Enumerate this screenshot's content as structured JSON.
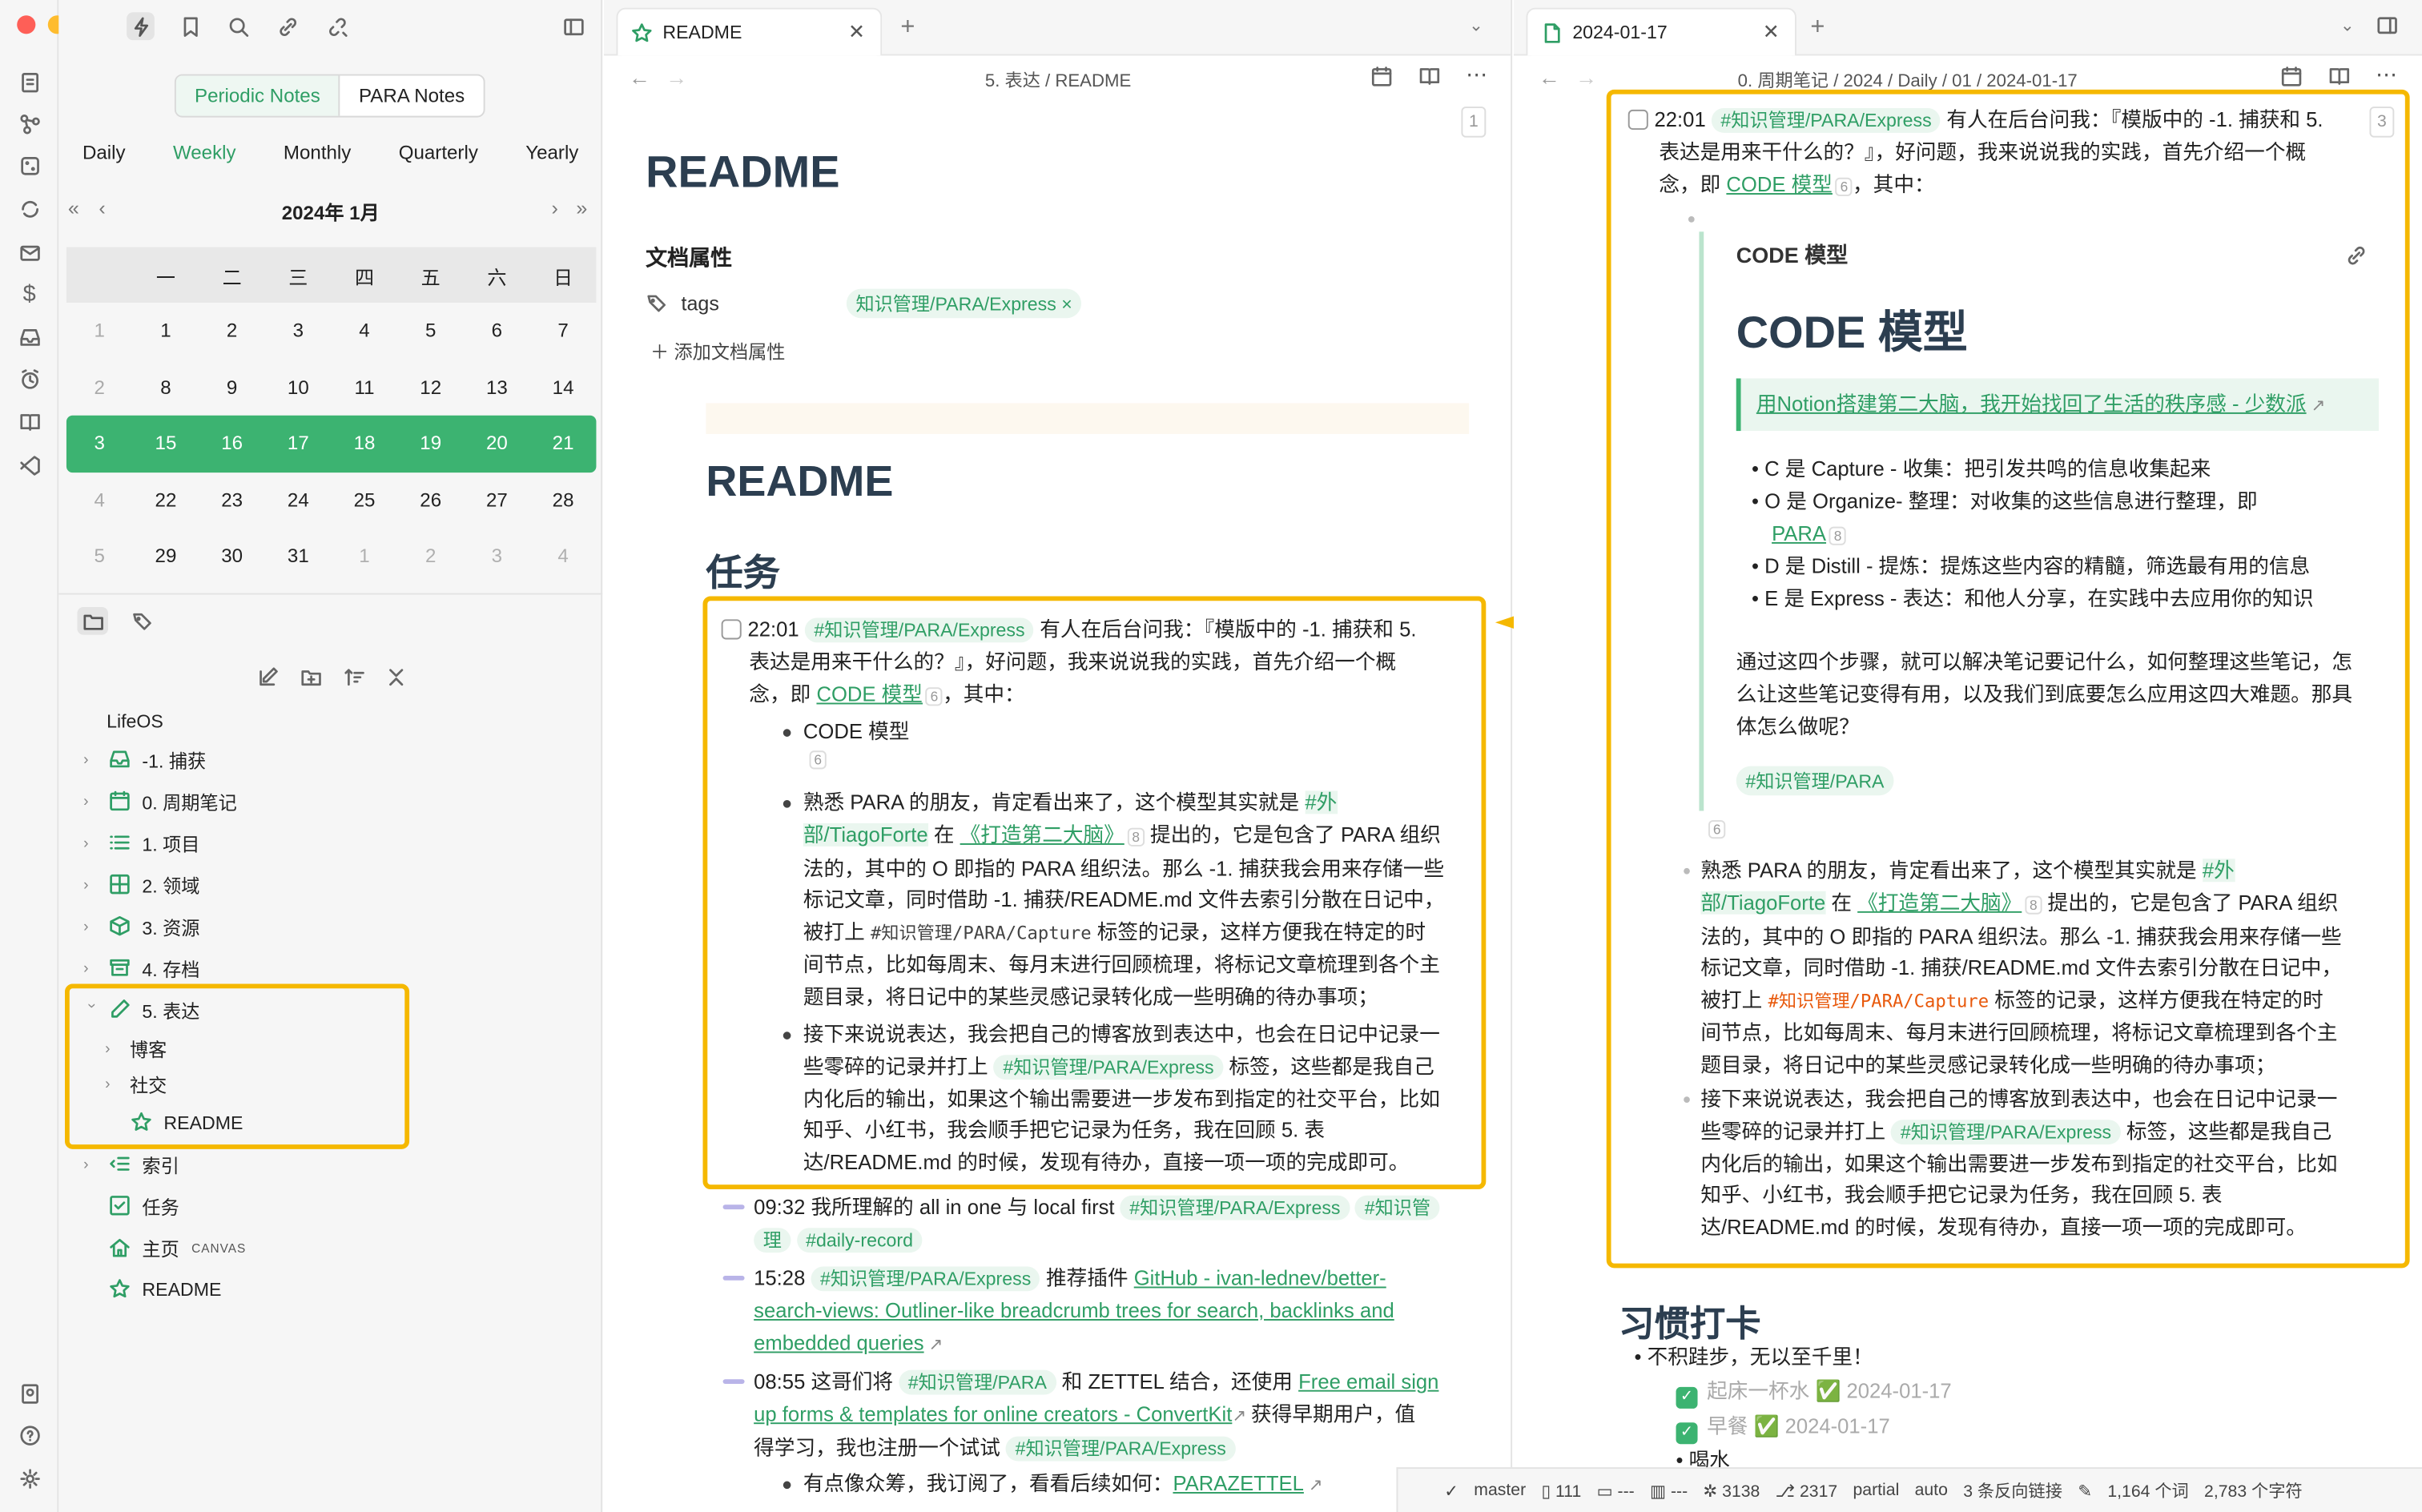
{
  "colors": {
    "accent": "#2f9e65",
    "highlight": "#f5b800",
    "calendar_current": "#3cb371"
  },
  "ribbon": {
    "icons": [
      "files-icon",
      "graph-icon",
      "dice-icon",
      "sync-icon",
      "mail-icon",
      "dollar-icon",
      "inbox-icon",
      "alarm-icon",
      "book-icon",
      "vscode-icon",
      "help-icon",
      "settings-icon"
    ]
  },
  "left": {
    "view_tabs": [
      "Periodic Notes",
      "PARA Notes"
    ],
    "periods": [
      "Daily",
      "Weekly",
      "Monthly",
      "Quarterly",
      "Yearly"
    ],
    "calendar": {
      "title": "2024年  1月",
      "weekdays": [
        "",
        "一",
        "二",
        "三",
        "四",
        "五",
        "六",
        "日"
      ],
      "rows": [
        [
          "1",
          "1",
          "2",
          "3",
          "4",
          "5",
          "6",
          "7"
        ],
        [
          "2",
          "8",
          "9",
          "10",
          "11",
          "12",
          "13",
          "14"
        ],
        [
          "3",
          "15",
          "16",
          "17",
          "18",
          "19",
          "20",
          "21"
        ],
        [
          "4",
          "22",
          "23",
          "24",
          "25",
          "26",
          "27",
          "28"
        ],
        [
          "5",
          "29",
          "30",
          "31",
          "1",
          "2",
          "3",
          "4"
        ]
      ]
    },
    "vault": "LifeOS",
    "tree": [
      "-1. 捕获",
      "0. 周期笔记",
      "1. 项目",
      "2. 领域",
      "3. 资源",
      "4. 存档",
      "5. 表达",
      "博客",
      "社交",
      "README",
      "索引",
      "任务",
      "主页",
      "README"
    ],
    "canvas_badge": "CANVAS"
  },
  "mid": {
    "tab_title": "README",
    "breadcrumb": "5. 表达  /  README",
    "page_num": "1",
    "h1": "README",
    "props_heading": "文档属性",
    "prop_key": "tags",
    "prop_value": "知识管理/PARA/Express ×",
    "add_prop": "添加文档属性",
    "h1b": "README",
    "h2": "任务",
    "task_time": "22:01",
    "tag_express": "#知识管理/PARA/Express",
    "task_l1": "有人在后台问我：『模版中的 -1. 捕获和 5.",
    "task_l2": "表达是用来干什么的？』，好问题，我来说说我的实践，首先介绍一个概",
    "task_l3a": "念，即",
    "code_link": "CODE 模型",
    "n6": "6",
    "n8": "8",
    "task_l3b": "，其中：",
    "bullet1": "CODE 模型",
    "b2_l1": "熟悉 PARA 的朋友，肯定看出来了，这个模型其实就是",
    "b2_tag1": "#外",
    "b2_tag2": "部/TiagoForte",
    "b2_in": "在",
    "b2_book": "《打造第二大脑》",
    "b2_l2b": "提出的，它是包含了 PARA 组织",
    "b2_l3": "法的，其中的 O 即指的 PARA 组织法。那么 -1. 捕获我会用来存储一些",
    "b2_l4": "标记文章，同时借助 -1. 捕获/README.md 文件去索引分散在日记中，",
    "b2_l5a": "被打上",
    "b2_code": "#知识管理/PARA/Capture",
    "b2_l5b": "标签的记录，这样方便我在特定的时",
    "b2_l6": "间节点，比如每周末、每月末进行回顾梳理，将标记文章梳理到各个主",
    "b2_l7": "题目录，将日记中的某些灵感记录转化成一些明确的待办事项；",
    "b3_l1": "接下来说说表达，我会把自己的博客放到表达中，也会在日记中记录一",
    "b3_l2a": "些零碎的记录并打上",
    "b3_l2b": "标签，这些都是我自己",
    "b3_l3": "内化后的输出，如果这个输出需要进一步发布到指定的社交平台，比如",
    "b3_l4": "知乎、小红书，我会顺手把它记录为任务，我在回顾 5. 表",
    "b3_l5": "达/README.md 的时候，发现有待办，直接一项一项的完成即可。",
    "e1_time": "09:32",
    "e1_text": "我所理解的 all in one 与 local first",
    "e1_tag2": "#知识管",
    "e1_tag2b": "理",
    "e1_tag3": "#daily-record",
    "e2_time": "15:28",
    "e2_text": "推荐插件",
    "e2_link1": "GitHub - ivan-lednev/better-",
    "e2_link2": "search-views: Outliner-like breadcrumb trees for search, backlinks and",
    "e2_link3": "embedded queries",
    "e3_time": "08:55",
    "e3_text": "这哥们将",
    "e3_tag": "#知识管理/PARA",
    "e3_text2": "和 ZETTEL 结合，还使用",
    "e3_link1": "Free email sign",
    "e3_link2": "up forms & templates for online creators - ConvertKit",
    "e3_text3": "获得早期用户，值",
    "e3_l3": "得学习，我也注册一个试试",
    "e4": "有点像众筹，我订阅了，看看后续如何：",
    "e4_link": "PARAZETTEL"
  },
  "right": {
    "tab_title": "2024-01-17",
    "breadcrumb": "0. 周期笔记  /  2024  /  Daily  /  01  /  2024-01-17",
    "page_num": "3",
    "embed_title": "CODE 模型",
    "embed_h1": "CODE 模型",
    "quote_link": "用Notion搭建第二大脑，我开始找回了生活的秩序感 - 少数派",
    "c": "C 是 Capture - 收集：把引发共鸣的信息收集起来",
    "o1": "O 是 Organize- 整理：对收集的这些信息进行整理，即",
    "o2": "PARA",
    "d": "D 是 Distill - 提炼：提炼这些内容的精髓，筛选最有用的信息",
    "e": "E 是 Express - 表达：和他人分享，在实践中去应用你的知识",
    "p1": "通过这四个步骤，就可以解决笔记要记什么，如何整理这些笔记，怎",
    "p2": "么让这些笔记变得有用，以及我们到底要怎么应用这四大难题。那具",
    "p3": "体怎么做呢？",
    "tag_para": "#知识管理/PARA",
    "habit_h2": "习惯打卡",
    "habit_intro": "不积跬步，无以至千里！",
    "habit1": "起床一杯水 ✅ 2024-01-17",
    "habit2": "早餐 ✅ 2024-01-17",
    "habit3": "喝水"
  },
  "status": {
    "branch": "master",
    "a": "111",
    "b": "---",
    "c": "---",
    "d": "3138",
    "e": "2317",
    "f": "partial",
    "g": "auto",
    "backlinks": "3 条反向链接",
    "words": "1,164 个词",
    "chars": "2,783 个字符"
  }
}
